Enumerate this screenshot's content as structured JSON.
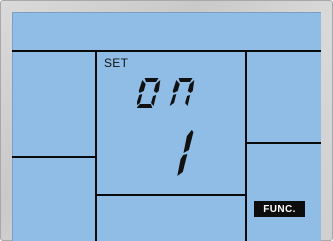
{
  "display": {
    "mode_label": "SET",
    "status_text": "on",
    "value_text": "1",
    "func_label": "FUNC."
  },
  "colors": {
    "lcd_background": "#8fbde6",
    "segment": "#111111",
    "bezel": "#d3d3d3",
    "badge_background": "#0d0d0d",
    "badge_text": "#ffffff"
  }
}
